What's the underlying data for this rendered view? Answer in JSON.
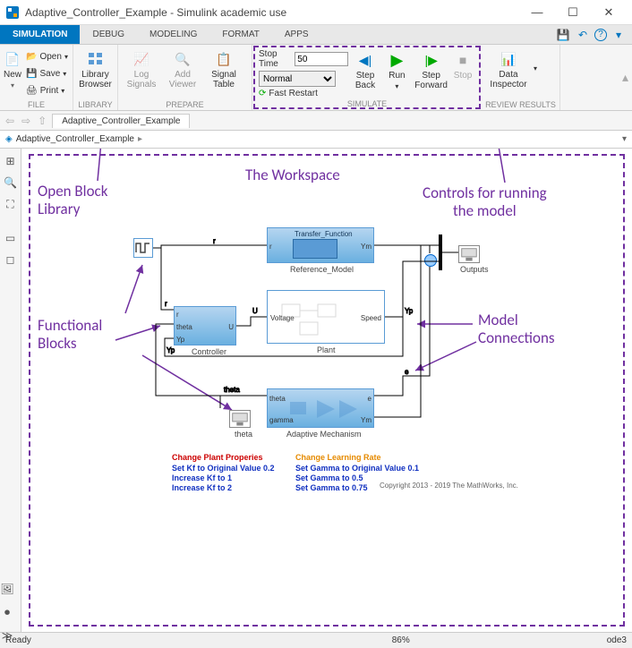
{
  "window": {
    "title": "Adaptive_Controller_Example - Simulink academic use"
  },
  "tabs": {
    "simulation": "SIMULATION",
    "debug": "DEBUG",
    "modeling": "MODELING",
    "format": "FORMAT",
    "apps": "APPS"
  },
  "ribbon": {
    "file": {
      "label": "FILE",
      "new": "New",
      "open": "Open",
      "save": "Save",
      "print": "Print"
    },
    "library": {
      "label": "LIBRARY",
      "browser": "Library\nBrowser"
    },
    "prepare": {
      "label": "PREPARE",
      "log": "Log\nSignals",
      "viewer": "Add\nViewer",
      "signal": "Signal\nTable"
    },
    "simulate": {
      "label": "SIMULATE",
      "stoptime": "Stop Time",
      "stoptime_val": "50",
      "mode": "Normal",
      "fast": "Fast Restart",
      "stepback": "Step\nBack",
      "run": "Run",
      "stepfwd": "Step\nForward",
      "stop": "Stop"
    },
    "review": {
      "label": "REVIEW RESULTS",
      "inspector": "Data\nInspector"
    }
  },
  "model": {
    "tab": "Adaptive_Controller_Example",
    "crumb": "Adaptive_Controller_Example"
  },
  "annotations": {
    "workspace": "The Workspace",
    "openlib": "Open Block\nLibrary",
    "controls": "Controls for running\nthe model",
    "funcblocks": "Functional\nBlocks",
    "connections": "Model\nConnections"
  },
  "blocks": {
    "ref": "Reference_Model",
    "tf": "Transfer_Function",
    "plant": "Plant",
    "ctrl": "Controller",
    "mech": "Adaptive Mechanism",
    "outputs": "Outputs",
    "voltage": "Voltage",
    "speed": "Speed",
    "r": "r",
    "u": "U",
    "yp": "Yp",
    "theta": "theta",
    "ym": "Ym",
    "e": "e",
    "gamma": "gamma"
  },
  "footer": {
    "plant_h": "Change Plant Properies",
    "plant_1": "Set Kf to Original Value 0.2",
    "plant_2": "Increase Kf to 1",
    "plant_3": "Increase Kf to 2",
    "lr_h": "Change Learning Rate",
    "lr_1": "Set Gamma to Original Value 0.1",
    "lr_2": "Set Gamma to 0.5",
    "lr_3": "Set Gamma to 0.75",
    "copy": "Copyright 2013 - 2019 The MathWorks, Inc."
  },
  "status": {
    "ready": "Ready",
    "zoom": "86%",
    "solver": "ode3"
  }
}
